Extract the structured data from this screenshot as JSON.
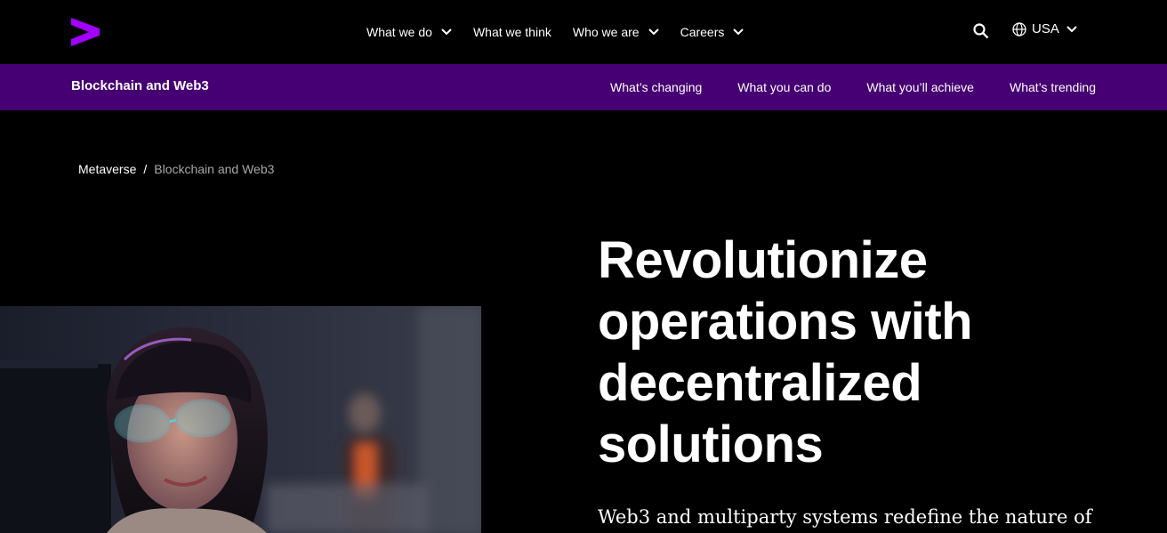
{
  "header": {
    "logo": "accenture-greater-than-logo",
    "nav": [
      {
        "label": "What we do",
        "has_dropdown": true
      },
      {
        "label": "What we think",
        "has_dropdown": false
      },
      {
        "label": "Who we are",
        "has_dropdown": true
      },
      {
        "label": "Careers",
        "has_dropdown": true
      }
    ],
    "search_icon": "search-icon",
    "country": {
      "label": "USA",
      "icon": "globe-icon"
    }
  },
  "subnav": {
    "title": "Blockchain and Web3",
    "links": [
      "What’s changing",
      "What you can do",
      "What you’ll achieve",
      "What’s trending"
    ]
  },
  "breadcrumb": {
    "parent": "Metaverse",
    "separator": "/",
    "current": "Blockchain and Web3"
  },
  "hero": {
    "headline_lines": [
      "Revolutionize",
      "operations with",
      "decentralized",
      "solutions"
    ],
    "lede": "Web3 and multiparty systems redefine the nature of"
  },
  "colors": {
    "brand_purple": "#A100FF",
    "subnav_bg": "#460073",
    "background": "#000000"
  }
}
